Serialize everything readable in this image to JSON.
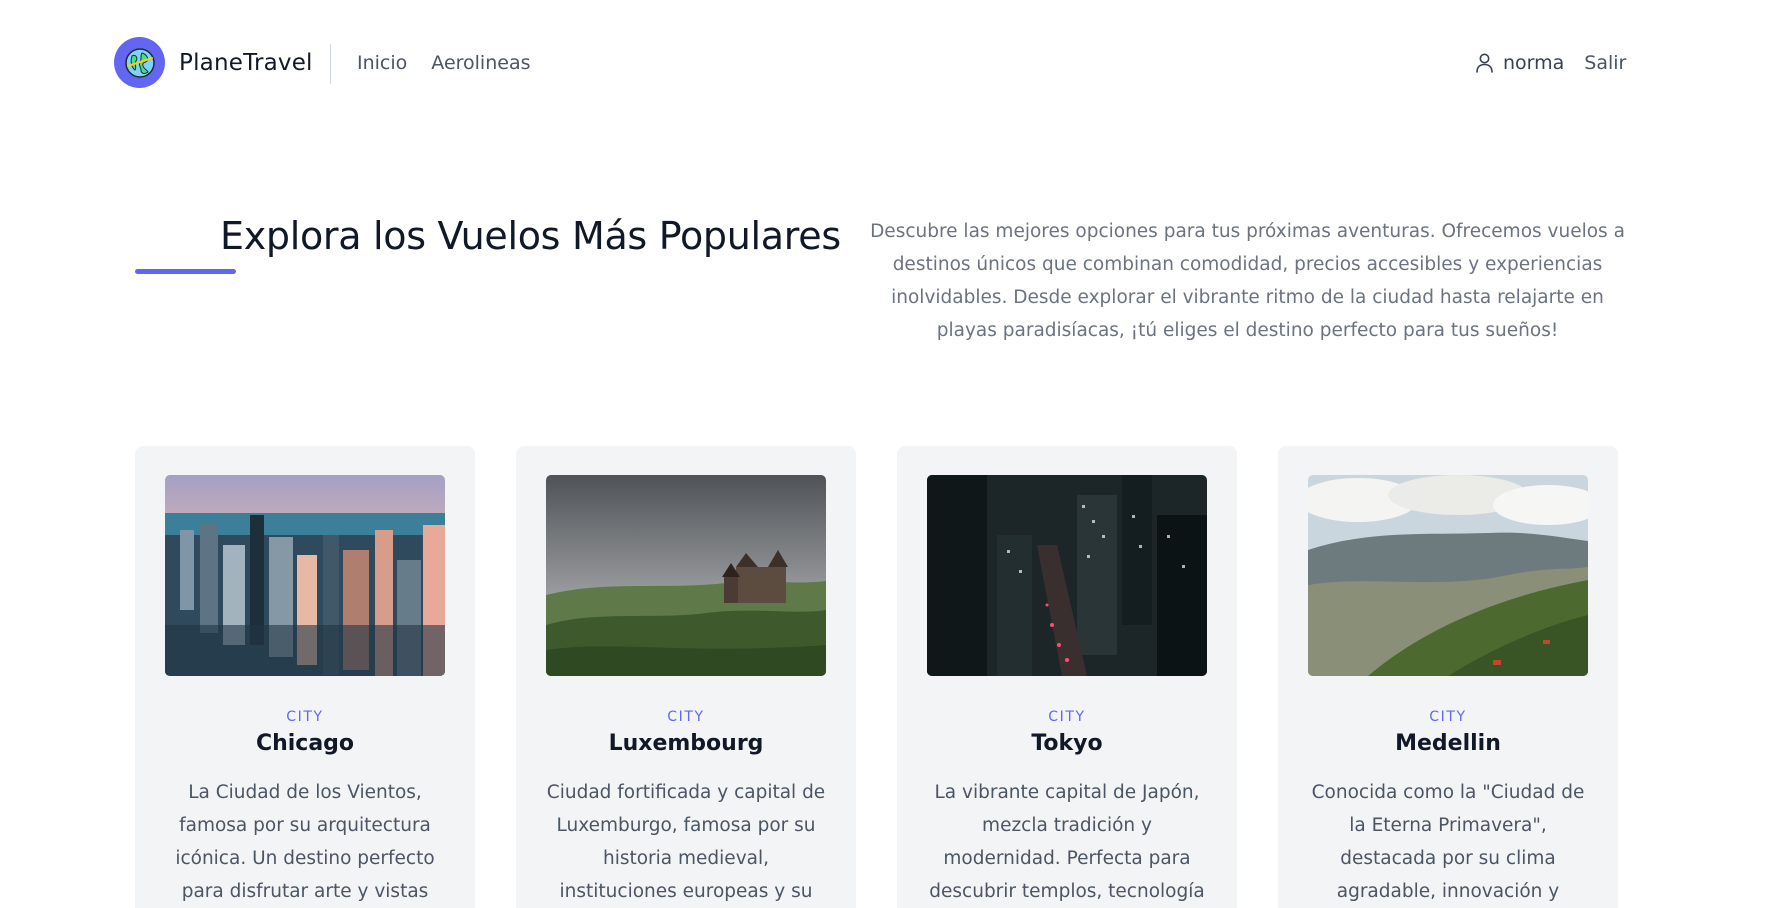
{
  "header": {
    "brand": "PlaneTravel",
    "nav": [
      "Inicio",
      "Aerolineas"
    ],
    "user": "norma",
    "logout": "Salir"
  },
  "hero": {
    "title": "Explora los Vuelos Más Populares",
    "description": "Descubre las mejores opciones para tus próximas aventuras. Ofrecemos vuelos a destinos únicos que combinan comodidad, precios accesibles y experiencias inolvidables. Desde explorar el vibrante ritmo de la ciudad hasta relajarte en playas paradisíacas, ¡tú eliges el destino perfecto para tus sueños!"
  },
  "cards": [
    {
      "tag": "CITY",
      "title": "Chicago",
      "description": "La Ciudad de los Vientos, famosa por su arquitectura icónica. Un destino perfecto para disfrutar arte y vistas"
    },
    {
      "tag": "CITY",
      "title": "Luxembourg",
      "description": "Ciudad fortificada y capital de Luxemburgo, famosa por su historia medieval, instituciones europeas y su papel como"
    },
    {
      "tag": "CITY",
      "title": "Tokyo",
      "description": "La vibrante capital de Japón, mezcla tradición y modernidad. Perfecta para descubrir templos, tecnología y"
    },
    {
      "tag": "CITY",
      "title": "Medellin",
      "description": "Conocida como la \"Ciudad de la Eterna Primavera\", destacada por su clima agradable, innovación y transformación"
    }
  ],
  "colors": {
    "accent": "#6366f1",
    "card_bg": "#f3f4f6",
    "muted_text": "#6b7280"
  },
  "icons": [
    "globe-logo-icon",
    "user-icon"
  ]
}
